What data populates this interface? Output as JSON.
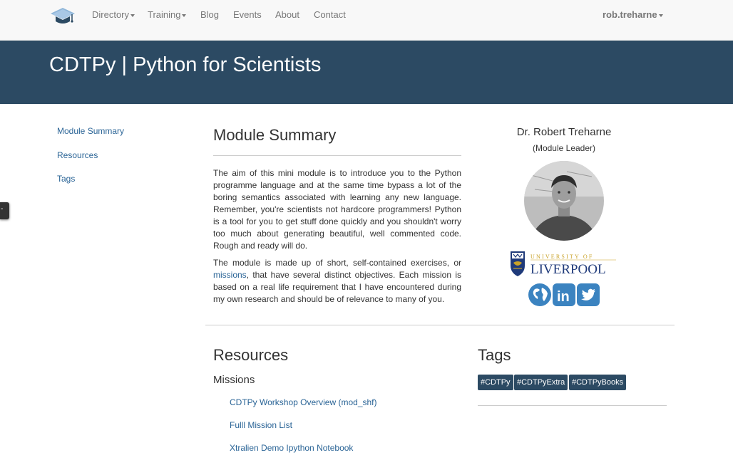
{
  "nav": {
    "items": [
      {
        "label": "Directory",
        "dropdown": true
      },
      {
        "label": "Training",
        "dropdown": true
      },
      {
        "label": "Blog",
        "dropdown": false
      },
      {
        "label": "Events",
        "dropdown": false
      },
      {
        "label": "About",
        "dropdown": false
      },
      {
        "label": "Contact",
        "dropdown": false
      }
    ],
    "user": "rob.treharne"
  },
  "banner": {
    "title": "CDTPy | Python for Scientists"
  },
  "sidebar": {
    "links": [
      "Module Summary",
      "Resources",
      "Tags"
    ],
    "tab_glyph": "-"
  },
  "summary": {
    "heading": "Module Summary",
    "para1": "The aim of this mini module is to introduce you to the Python programme language and at the same time bypass a lot of the boring semantics associated with learning any new language. Remember, you're scientists not hardcore programmers! Python is a tool for you to get stuff done quickly and you shouldn't worry too much about generating beautiful, well commented code. Rough and ready will do.",
    "para2_before": "The module is made up of short, self-contained exercises, or ",
    "para2_link": "missions",
    "para2_after": ", that have several distinct objectives. Each mission is based on a real life requirement that I have encountered during my own research and should be of relevance to many of you."
  },
  "leader": {
    "name": "Dr. Robert Treharne",
    "role": "(Module Leader)",
    "university_top": "UNIVERSITY OF",
    "university_name": "LIVERPOOL",
    "social_icons": [
      "globe-icon",
      "linkedin-icon",
      "twitter-icon"
    ],
    "linkedin_text": "in"
  },
  "resources": {
    "heading": "Resources",
    "subheading": "Missions",
    "links": [
      "CDTPy Workshop Overview (mod_shf)",
      "Fulll Mission List",
      "Xtralien Demo Ipython Notebook"
    ]
  },
  "tags": {
    "heading": "Tags",
    "items": [
      "#CDTPy",
      "#CDTPyExtra",
      "#CDTPyBooks"
    ]
  },
  "colors": {
    "banner": "#2c4a63",
    "link": "#2a6496",
    "navbar": "#f8f8f8",
    "tag": "#2c4a63",
    "social": "#3b83c0"
  }
}
